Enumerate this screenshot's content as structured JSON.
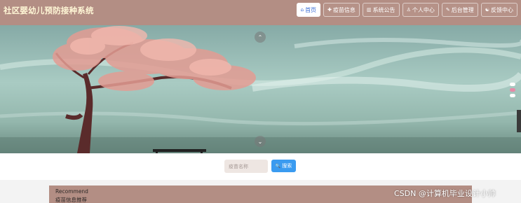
{
  "header": {
    "title": "社区婴幼儿预防接种系统",
    "nav": [
      {
        "icon": "home-icon",
        "glyph": "⌂",
        "label": "首页",
        "active": true
      },
      {
        "icon": "vaccine-icon",
        "glyph": "✚",
        "label": "疫苗信息",
        "active": false
      },
      {
        "icon": "announcement-icon",
        "glyph": "▥",
        "label": "系统公告",
        "active": false
      },
      {
        "icon": "user-icon",
        "glyph": "♙",
        "label": "个人中心",
        "active": false
      },
      {
        "icon": "admin-icon",
        "glyph": "✎",
        "label": "后台管理",
        "active": false
      },
      {
        "icon": "feedback-icon",
        "glyph": "☯",
        "label": "反馈中心",
        "active": false
      }
    ]
  },
  "banner": {
    "prev_glyph": "⌃",
    "next_glyph": "⌄",
    "slide_count": 3,
    "active_slide": 2
  },
  "search": {
    "placeholder": "疫苗名称",
    "button_glyph": "🔍",
    "button_label": "搜索"
  },
  "recommend": {
    "title_en": "Recommend",
    "title_cn": "疫苗信息推荐"
  },
  "watermark": "CSDN @计算机毕业设计小帅"
}
